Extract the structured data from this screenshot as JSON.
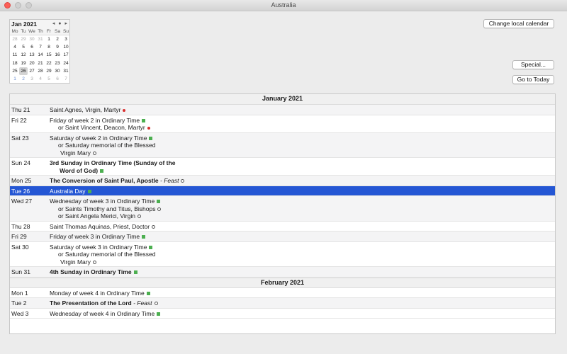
{
  "window": {
    "title": "Australia"
  },
  "minical": {
    "month_label": "Jan 2021",
    "nav": [
      "◂",
      "●",
      "▸"
    ],
    "dow": [
      "Mo",
      "Tu",
      "We",
      "Th",
      "Fr",
      "Sa",
      "Su"
    ],
    "weeks": [
      [
        {
          "d": "28",
          "t": "other"
        },
        {
          "d": "29",
          "t": "other"
        },
        {
          "d": "30",
          "t": "other"
        },
        {
          "d": "31",
          "t": "other"
        },
        {
          "d": "1",
          "t": ""
        },
        {
          "d": "2",
          "t": ""
        },
        {
          "d": "3",
          "t": ""
        }
      ],
      [
        {
          "d": "4",
          "t": ""
        },
        {
          "d": "5",
          "t": ""
        },
        {
          "d": "6",
          "t": ""
        },
        {
          "d": "7",
          "t": ""
        },
        {
          "d": "8",
          "t": ""
        },
        {
          "d": "9",
          "t": ""
        },
        {
          "d": "10",
          "t": ""
        }
      ],
      [
        {
          "d": "11",
          "t": ""
        },
        {
          "d": "12",
          "t": ""
        },
        {
          "d": "13",
          "t": ""
        },
        {
          "d": "14",
          "t": ""
        },
        {
          "d": "15",
          "t": ""
        },
        {
          "d": "16",
          "t": ""
        },
        {
          "d": "17",
          "t": ""
        }
      ],
      [
        {
          "d": "18",
          "t": ""
        },
        {
          "d": "19",
          "t": ""
        },
        {
          "d": "20",
          "t": ""
        },
        {
          "d": "21",
          "t": ""
        },
        {
          "d": "22",
          "t": ""
        },
        {
          "d": "23",
          "t": ""
        },
        {
          "d": "24",
          "t": ""
        }
      ],
      [
        {
          "d": "25",
          "t": ""
        },
        {
          "d": "26",
          "t": "sel"
        },
        {
          "d": "27",
          "t": ""
        },
        {
          "d": "28",
          "t": ""
        },
        {
          "d": "29",
          "t": ""
        },
        {
          "d": "30",
          "t": ""
        },
        {
          "d": "31",
          "t": ""
        }
      ],
      [
        {
          "d": "1",
          "t": "next"
        },
        {
          "d": "2",
          "t": "next"
        },
        {
          "d": "3",
          "t": "other"
        },
        {
          "d": "4",
          "t": "other"
        },
        {
          "d": "5",
          "t": "other"
        },
        {
          "d": "6",
          "t": "other"
        },
        {
          "d": "7",
          "t": "other"
        }
      ]
    ]
  },
  "buttons": {
    "change_calendar": "Change local calendar",
    "special": "Special...",
    "today": "Go to Today"
  },
  "marker_colors": {
    "green-square": "#4caf50",
    "red-dot": "#d93030",
    "selected_row": "#2456d4"
  },
  "sections": [
    {
      "month": "January 2021",
      "days": [
        {
          "date": "Thu 21",
          "alt": true,
          "entries": [
            {
              "text": "Saint Agnes, Virgin, Martyr",
              "marker": "red-dot",
              "bold": false,
              "indent": 0
            }
          ]
        },
        {
          "date": "Fri 22",
          "alt": false,
          "entries": [
            {
              "text": "Friday of week 2 in Ordinary Time",
              "marker": "green-square",
              "indent": 0
            },
            {
              "text": "or Saint Vincent, Deacon, Martyr",
              "marker": "red-dot",
              "indent": 1
            }
          ]
        },
        {
          "date": "Sat 23",
          "alt": true,
          "entries": [
            {
              "text": "Saturday of week 2 in Ordinary Time",
              "marker": "green-square",
              "indent": 0
            },
            {
              "text": "or Saturday memorial of the Blessed",
              "marker": "",
              "indent": 1
            },
            {
              "text": "Virgin Mary",
              "marker": "white-circle",
              "indent": 2
            }
          ]
        },
        {
          "date": "Sun 24",
          "alt": false,
          "entries": [
            {
              "text": "3rd Sunday in Ordinary Time (Sunday of the",
              "marker": "",
              "bold": true,
              "indent": 0
            },
            {
              "text": "Word of God)",
              "marker": "green-square",
              "bold": true,
              "indent": 3
            }
          ]
        },
        {
          "date": "Mon 25",
          "alt": true,
          "entries": [
            {
              "text": "The Conversion of Saint Paul, Apostle",
              "suffix": " - Feast",
              "marker": "white-circle",
              "bold": true,
              "indent": 0
            }
          ]
        },
        {
          "date": "Tue 26",
          "alt": false,
          "selected": true,
          "entries": [
            {
              "text": "Australia Day",
              "marker": "green-square",
              "indent": 0
            }
          ]
        },
        {
          "date": "Wed 27",
          "alt": true,
          "entries": [
            {
              "text": "Wednesday of week 3 in Ordinary Time",
              "marker": "green-square",
              "indent": 0
            },
            {
              "text": "or Saints Timothy and Titus, Bishops",
              "marker": "white-circle",
              "indent": 1
            },
            {
              "text": "or Saint Angela Merici, Virgin",
              "marker": "white-circle",
              "indent": 1
            }
          ]
        },
        {
          "date": "Thu 28",
          "alt": false,
          "entries": [
            {
              "text": "Saint Thomas Aquinas, Priest, Doctor",
              "marker": "white-circle",
              "indent": 0
            }
          ]
        },
        {
          "date": "Fri 29",
          "alt": true,
          "entries": [
            {
              "text": "Friday of week 3 in Ordinary Time",
              "marker": "green-square",
              "indent": 0
            }
          ]
        },
        {
          "date": "Sat 30",
          "alt": false,
          "entries": [
            {
              "text": "Saturday of week 3 in Ordinary Time",
              "marker": "green-square",
              "indent": 0
            },
            {
              "text": "or Saturday memorial of the Blessed",
              "marker": "",
              "indent": 1
            },
            {
              "text": "Virgin Mary",
              "marker": "white-circle",
              "indent": 2
            }
          ]
        },
        {
          "date": "Sun 31",
          "alt": true,
          "entries": [
            {
              "text": "4th Sunday in Ordinary Time",
              "marker": "green-square",
              "bold": true,
              "indent": 0
            }
          ]
        }
      ]
    },
    {
      "month": "February 2021",
      "days": [
        {
          "date": "Mon 1",
          "alt": false,
          "entries": [
            {
              "text": "Monday of week 4 in Ordinary Time",
              "marker": "green-square",
              "indent": 0
            }
          ]
        },
        {
          "date": "Tue 2",
          "alt": true,
          "entries": [
            {
              "text": "The Presentation of the Lord",
              "suffix": " - Feast",
              "marker": "white-circle",
              "bold": true,
              "indent": 0
            }
          ]
        },
        {
          "date": "Wed 3",
          "alt": false,
          "entries": [
            {
              "text": "Wednesday of week 4 in Ordinary Time",
              "marker": "green-square",
              "indent": 0
            }
          ]
        }
      ]
    }
  ]
}
